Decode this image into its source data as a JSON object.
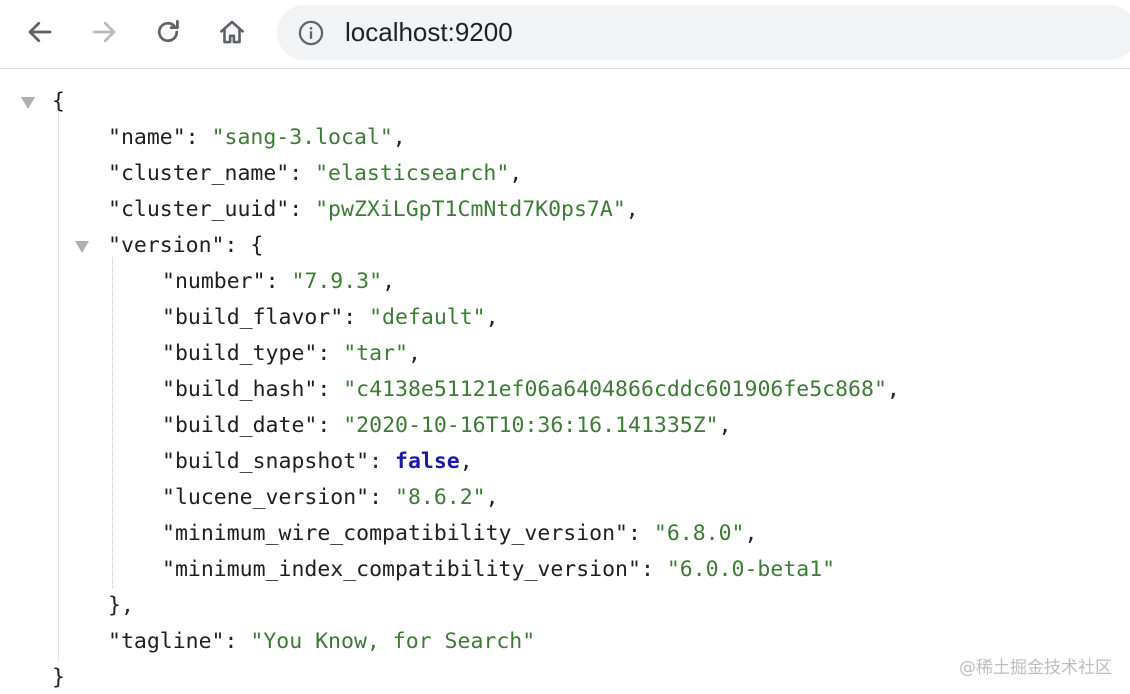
{
  "browser": {
    "url": "localhost:9200",
    "icons": {
      "back": "arrow-left-icon",
      "forward": "arrow-right-icon",
      "reload": "reload-icon",
      "home": "home-icon",
      "site_info": "info-icon"
    }
  },
  "json": {
    "name_key": "\"name\"",
    "name_value": "\"sang-3.local\"",
    "cluster_name_key": "\"cluster_name\"",
    "cluster_name_value": "\"elasticsearch\"",
    "cluster_uuid_key": "\"cluster_uuid\"",
    "cluster_uuid_value": "\"pwZXiLGpT1CmNtd7K0ps7A\"",
    "version_key": "\"version\"",
    "version": {
      "number_key": "\"number\"",
      "number_value": "\"7.9.3\"",
      "build_flavor_key": "\"build_flavor\"",
      "build_flavor_value": "\"default\"",
      "build_type_key": "\"build_type\"",
      "build_type_value": "\"tar\"",
      "build_hash_key": "\"build_hash\"",
      "build_hash_value": "\"c4138e51121ef06a6404866cddc601906fe5c868\"",
      "build_date_key": "\"build_date\"",
      "build_date_value": "\"2020-10-16T10:36:16.141335Z\"",
      "build_snapshot_key": "\"build_snapshot\"",
      "build_snapshot_value": "false",
      "lucene_version_key": "\"lucene_version\"",
      "lucene_version_value": "\"8.6.2\"",
      "minimum_wire_compatibility_version_key": "\"minimum_wire_compatibility_version\"",
      "minimum_wire_compatibility_version_value": "\"6.8.0\"",
      "minimum_index_compatibility_version_key": "\"minimum_index_compatibility_version\"",
      "minimum_index_compatibility_version_value": "\"6.0.0-beta1\""
    },
    "tagline_key": "\"tagline\"",
    "tagline_value": "\"You Know, for Search\""
  },
  "colors": {
    "string": "#3c7a36",
    "boolean": "#1a1aa6",
    "key": "#1f1f1f"
  },
  "watermark": "@稀土掘金技术社区"
}
